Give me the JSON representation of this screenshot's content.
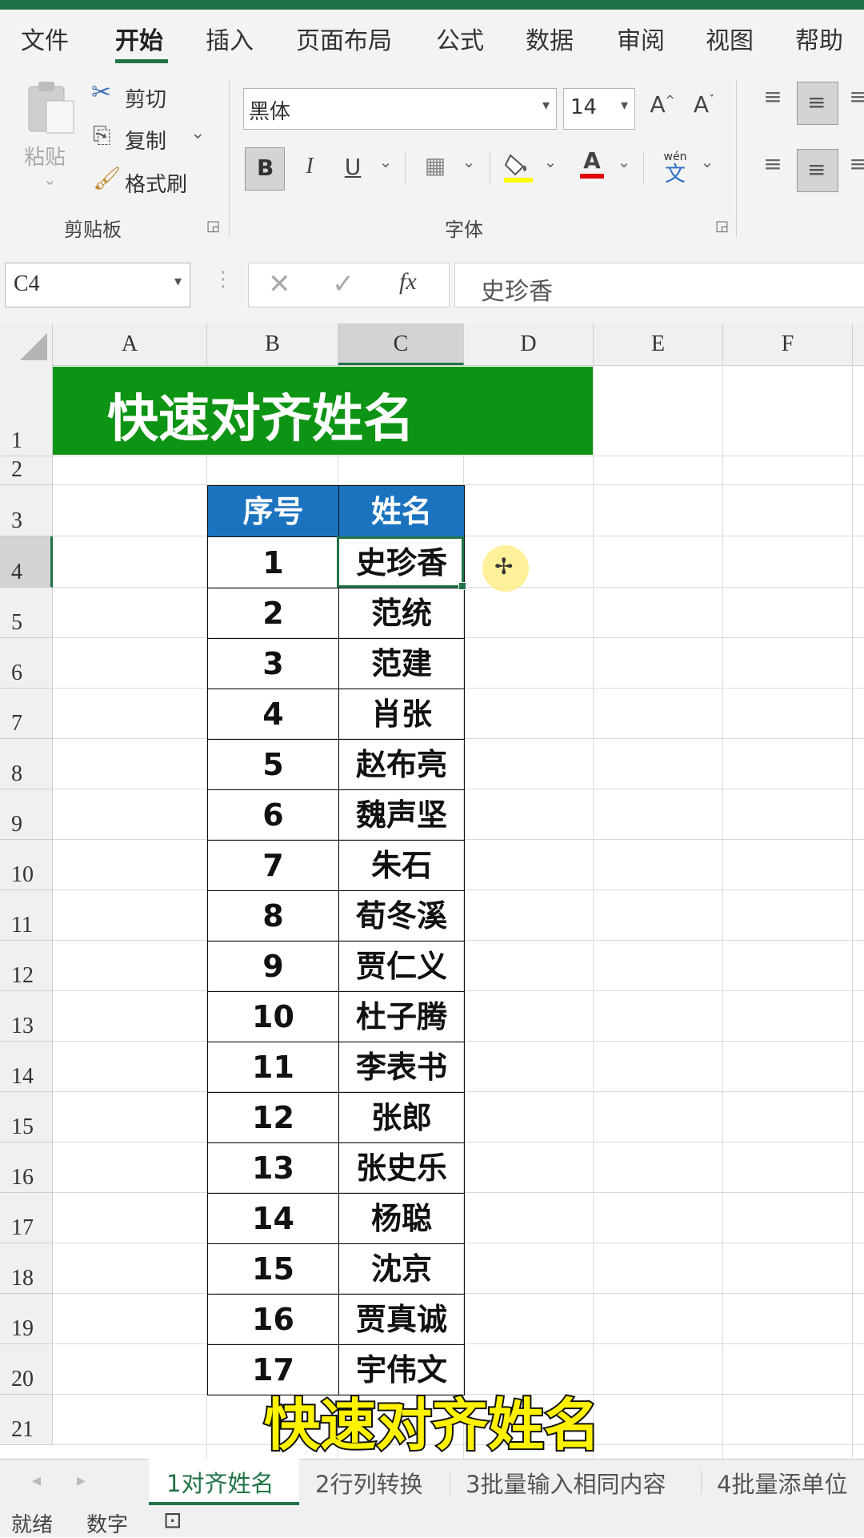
{
  "ribbon_tabs": [
    "文件",
    "开始",
    "插入",
    "页面布局",
    "公式",
    "数据",
    "审阅",
    "视图",
    "帮助"
  ],
  "clipboard": {
    "paste_label": "粘贴",
    "cut_label": "剪切",
    "copy_label": "复制",
    "format_painter_label": "格式刷",
    "group_label": "剪贴板"
  },
  "font_group": {
    "font_name": "黑体",
    "font_size": "14",
    "grow_label": "A",
    "shrink_label": "A",
    "bold_label": "B",
    "italic_label": "I",
    "underline_label": "U",
    "font_color_label": "A",
    "phonetic_top": "wén",
    "phonetic_bottom": "文",
    "group_label": "字体"
  },
  "formula_bar": {
    "name_box": "C4",
    "fx_label": "fx",
    "content": "史珍香"
  },
  "columns": [
    "A",
    "B",
    "C",
    "D",
    "E",
    "F"
  ],
  "selected_column": "C",
  "rows": [
    "1",
    "2",
    "3",
    "4",
    "5",
    "6",
    "7",
    "8",
    "9",
    "10",
    "11",
    "12",
    "13",
    "14",
    "15",
    "16",
    "17",
    "18",
    "19",
    "20",
    "21"
  ],
  "selected_row": "4",
  "banner_title": "快速对齐姓名",
  "table": {
    "headers": [
      "序号",
      "姓名"
    ],
    "records": [
      [
        "1",
        "史珍香"
      ],
      [
        "2",
        "范统"
      ],
      [
        "3",
        "范建"
      ],
      [
        "4",
        "肖张"
      ],
      [
        "5",
        "赵布亮"
      ],
      [
        "6",
        "魏声坚"
      ],
      [
        "7",
        "朱石"
      ],
      [
        "8",
        "荀冬溪"
      ],
      [
        "9",
        "贾仁义"
      ],
      [
        "10",
        "杜子腾"
      ],
      [
        "11",
        "李表书"
      ],
      [
        "12",
        "张郎"
      ],
      [
        "13",
        "张史乐"
      ],
      [
        "14",
        "杨聪"
      ],
      [
        "15",
        "沈京"
      ],
      [
        "16",
        "贾真诚"
      ],
      [
        "17",
        "宇伟文"
      ]
    ]
  },
  "subtitle": "快速对齐姓名",
  "sheet_tabs": [
    "1对齐姓名",
    "2行列转换",
    "3批量输入相同内容",
    "4批量添单位"
  ],
  "status": {
    "ready": "就绪",
    "mode": "数字"
  },
  "colors": {
    "banner": "#0e9414",
    "table_header": "#1b73c0",
    "accent": "#217346",
    "subtitle_text": "#fff200"
  }
}
